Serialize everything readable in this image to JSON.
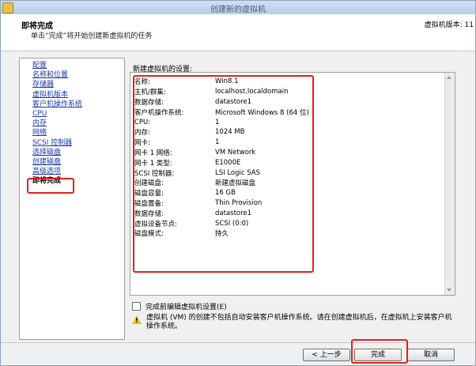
{
  "window": {
    "title": "创建新的虚拟机"
  },
  "header": {
    "title": "即将完成",
    "subtitle": "单击“完成”将开始创建新虚拟机的任务",
    "version": "虚拟机版本: 11"
  },
  "sidebar": {
    "items": [
      {
        "label": "配置",
        "active": false
      },
      {
        "label": "名称和位置",
        "active": false
      },
      {
        "label": "存储器",
        "active": false
      },
      {
        "label": "虚拟机版本",
        "active": false
      },
      {
        "label": "客户机操作系统",
        "active": false
      },
      {
        "label": "CPU",
        "active": false
      },
      {
        "label": "内存",
        "active": false
      },
      {
        "label": "网络",
        "active": false
      },
      {
        "label": "SCSI 控制器",
        "active": false
      },
      {
        "label": "选择磁盘",
        "active": false
      },
      {
        "label": "创建磁盘",
        "active": false
      },
      {
        "label": "高级选项",
        "active": false
      },
      {
        "label": "即将完成",
        "active": true
      }
    ]
  },
  "settings": {
    "label": "新建虚拟机的设置:",
    "rows": [
      {
        "key": "名称:",
        "value": "Win8.1"
      },
      {
        "key": "主机/群集:",
        "value": "localhost.localdomain"
      },
      {
        "key": "数据存储:",
        "value": "datastore1"
      },
      {
        "key": "客户机操作系统:",
        "value": "Microsoft Windows 8 (64 位)"
      },
      {
        "key": "CPU:",
        "value": "1"
      },
      {
        "key": "内存:",
        "value": "1024 MB"
      },
      {
        "key": "网卡:",
        "value": "1"
      },
      {
        "key": "网卡 1 网络:",
        "value": "VM Network"
      },
      {
        "key": "网卡 1 类型:",
        "value": "E1000E"
      },
      {
        "key": "SCSI 控制器:",
        "value": "LSI Logic SAS"
      },
      {
        "key": "创建磁盘:",
        "value": "新建虚拟磁盘"
      },
      {
        "key": "磁盘容量:",
        "value": "16 GB"
      },
      {
        "key": "磁盘置备:",
        "value": "Thin Provision"
      },
      {
        "key": "数据存储:",
        "value": "datastore1"
      },
      {
        "key": "虚拟设备节点:",
        "value": "SCSI (0:0)"
      },
      {
        "key": "磁盘模式:",
        "value": "持久"
      }
    ]
  },
  "edit_checkbox": {
    "label": "完成前编辑虚拟机设置(E)",
    "checked": false
  },
  "warning": {
    "icon": "warning-icon",
    "text": "虚拟机 (VM) 的创建不包括自动安装客户机操作系统。请在创建虚拟机后，在虚拟机上安装客户机操作系统。"
  },
  "buttons": {
    "back": "< 上一步",
    "finish": "完成",
    "cancel": "取消"
  },
  "colors": {
    "highlight": "#e0211d",
    "link": "#1a3aa8"
  }
}
